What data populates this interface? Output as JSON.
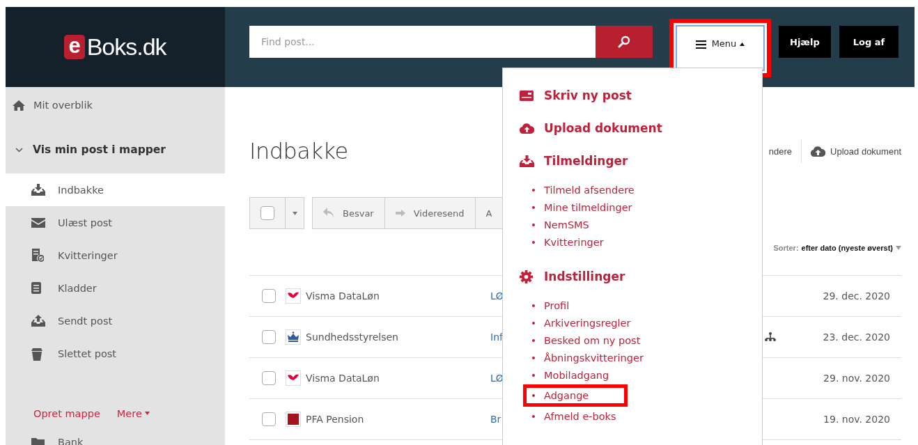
{
  "logo": {
    "badge": "e",
    "text": "Boks.dk"
  },
  "search": {
    "placeholder": "Find post..."
  },
  "header_buttons": [
    {
      "kind": "menu",
      "label": "Menu",
      "expanded": true,
      "highlighted": true
    },
    {
      "kind": "plain",
      "label": "Hjælp",
      "highlighted": false
    },
    {
      "kind": "plain",
      "label": "Log af",
      "highlighted": false
    }
  ],
  "sidebar": {
    "overview": "Mit overblik",
    "section": {
      "label": "Vis min post i mapper",
      "expanded": true
    },
    "folders": [
      {
        "kind": "inbox",
        "label": "Indbakke",
        "selected": true
      },
      {
        "kind": "unread",
        "label": "Ulæst post",
        "selected": false
      },
      {
        "kind": "receipts",
        "label": "Kvitteringer",
        "selected": false
      },
      {
        "kind": "drafts",
        "label": "Kladder",
        "selected": false
      },
      {
        "kind": "sent",
        "label": "Sendt post",
        "selected": false
      },
      {
        "kind": "deleted",
        "label": "Slettet post",
        "selected": false
      }
    ],
    "links": [
      {
        "label": "Opret mappe",
        "dropdown": false
      },
      {
        "label": "Mere",
        "dropdown": true
      }
    ],
    "custom_folders": [
      {
        "label": "Bank",
        "selected": false
      }
    ]
  },
  "main": {
    "title": "Indbakke",
    "actions": [
      {
        "kind": "text",
        "label": "ndere"
      },
      {
        "kind": "upload",
        "label": "Upload dokument"
      }
    ],
    "toolbar": {
      "select_all": {
        "checked": false
      },
      "buttons": [
        {
          "kind": "reply",
          "label": "Besvar"
        },
        {
          "kind": "forward",
          "label": "Videresend"
        },
        {
          "kind": "plain",
          "label": "A"
        }
      ]
    },
    "sort": {
      "label": "Sorter:",
      "value": "efter dato (nyeste øverst)"
    },
    "messages": [
      {
        "kind": "visma",
        "sender": "Visma DataLøn",
        "subject": "LØ",
        "date": "29. dec. 2020",
        "checked": false,
        "icon_shown": false
      },
      {
        "kind": "crown",
        "sender": "Sundhedsstyrelsen",
        "subject": "Inf",
        "date": "23. dec. 2020",
        "checked": false,
        "icon_shown": true
      },
      {
        "kind": "visma",
        "sender": "Visma DataLøn",
        "subject": "LØ",
        "date": "29. nov. 2020",
        "checked": false,
        "icon_shown": false
      },
      {
        "kind": "pfa",
        "sender": "PFA Pension",
        "subject": "Br",
        "date": "19. nov. 2020",
        "checked": false,
        "icon_shown": false
      }
    ]
  },
  "menu": {
    "sections": [
      {
        "kind": "compose",
        "title": "Skriv ny post"
      },
      {
        "kind": "upload",
        "title": "Upload dokument"
      },
      {
        "kind": "subscribe",
        "title": "Tilmeldinger",
        "items": [
          {
            "label": "Tilmeld afsendere",
            "highlighted": false
          },
          {
            "label": "Mine tilmeldinger",
            "highlighted": false
          },
          {
            "label": "NemSMS",
            "highlighted": false
          },
          {
            "label": "Kvitteringer",
            "highlighted": false
          }
        ]
      },
      {
        "kind": "settings",
        "title": "Indstillinger",
        "items": [
          {
            "label": "Profil",
            "highlighted": false
          },
          {
            "label": "Arkiveringsregler",
            "highlighted": false
          },
          {
            "label": "Besked om ny post",
            "highlighted": false
          },
          {
            "label": "Åbningskvitteringer",
            "highlighted": false
          },
          {
            "label": "Mobiladgang",
            "highlighted": false
          },
          {
            "label": "Adgange",
            "highlighted": true
          },
          {
            "label": "Afmeld e-boks",
            "highlighted": false
          }
        ]
      }
    ]
  }
}
